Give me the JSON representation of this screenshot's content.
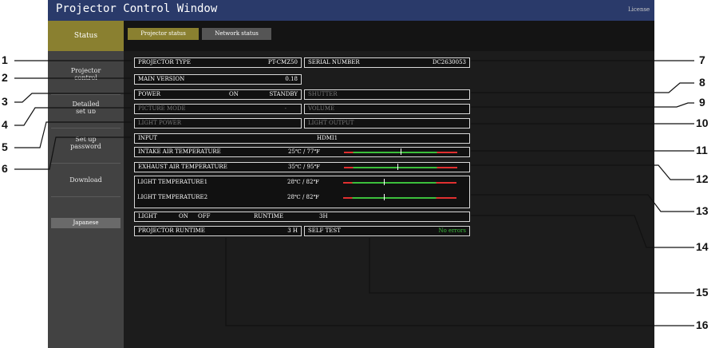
{
  "window": {
    "title": "Projector Control Window",
    "license_link": "License"
  },
  "sidebar": {
    "items": [
      {
        "label": "Status"
      },
      {
        "label": "Projector\ncontrol"
      },
      {
        "label": "Detailed\nset up"
      },
      {
        "label": "Set up\npassword"
      },
      {
        "label": "Download"
      }
    ],
    "language_button": "Japanese"
  },
  "tabs": [
    {
      "label": "Projector status",
      "active": true
    },
    {
      "label": "Network status",
      "active": false
    }
  ],
  "status": {
    "projector_type": {
      "label": "PROJECTOR TYPE",
      "value": "PT-CMZ50"
    },
    "serial_number": {
      "label": "SERIAL NUMBER",
      "value": "DC2630053"
    },
    "main_version": {
      "label": "MAIN VERSION",
      "value": "0.18"
    },
    "power": {
      "label": "POWER",
      "on": "ON",
      "standby": "STANDBY"
    },
    "shutter": {
      "label": "SHUTTER"
    },
    "picture_mode": {
      "label": "PICTURE MODE",
      "value": "-"
    },
    "volume": {
      "label": "VOLUME"
    },
    "light_power": {
      "label": "LIGHT POWER"
    },
    "light_output": {
      "label": "LIGHT OUTPUT"
    },
    "input": {
      "label": "INPUT",
      "value": "HDMI1"
    },
    "temperatures": [
      {
        "label": "INTAKE AIR TEMPERATURE",
        "value": "25℃ / 77℉",
        "level": 0.5
      },
      {
        "label": "EXHAUST AIR TEMPERATURE",
        "value": "35℃ / 95℉",
        "level": 0.47
      },
      {
        "label": "LIGHT TEMPERATURE1",
        "value": "28℃ / 82℉",
        "level": 0.36
      },
      {
        "label": "LIGHT TEMPERATURE2",
        "value": "28℃ / 82℉",
        "level": 0.36
      }
    ],
    "light": {
      "label": "LIGHT",
      "on": "ON",
      "off": "OFF",
      "runtime_label": "RUNTIME",
      "runtime_value": "3H"
    },
    "projector_runtime": {
      "label": "PROJECTOR RUNTIME",
      "value": "3 H"
    },
    "self_test": {
      "label": "SELF TEST",
      "value": "No errors"
    }
  },
  "callouts": [
    "1",
    "2",
    "3",
    "4",
    "5",
    "6",
    "7",
    "8",
    "9",
    "10",
    "11",
    "12",
    "13",
    "14",
    "15",
    "16"
  ],
  "colors": {
    "title_bar": "#2a3a6a",
    "accent": "#8a8030",
    "gauge_green": "#3cbf3c",
    "gauge_red": "#e03030",
    "ok_text": "#3cbf3c"
  }
}
